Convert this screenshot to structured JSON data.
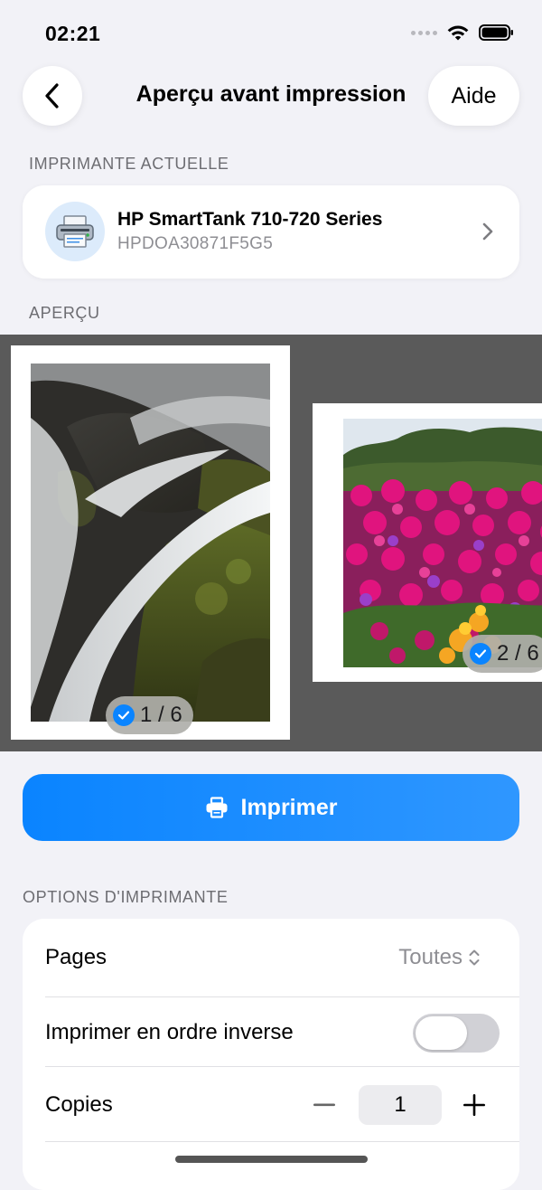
{
  "status_bar": {
    "time": "02:21"
  },
  "nav": {
    "title": "Aperçu avant impression",
    "help_label": "Aide"
  },
  "printer_section": {
    "label": "IMPRIMANTE ACTUELLE",
    "printer_name": "HP SmartTank 710-720 Series",
    "printer_id": "HPDOA30871F5G5"
  },
  "preview_section": {
    "label": "APERÇU",
    "pages": [
      {
        "badge": "1 / 6",
        "selected": true,
        "image": "waterfall-photo"
      },
      {
        "badge": "2 / 6",
        "selected": true,
        "image": "flowers-photo"
      }
    ]
  },
  "print_button": {
    "label": "Imprimer"
  },
  "options_section": {
    "label": "OPTIONS D'IMPRIMANTE",
    "pages_label": "Pages",
    "pages_value": "Toutes",
    "reverse_label": "Imprimer en ordre inverse",
    "reverse_on": false,
    "copies_label": "Copies",
    "copies_value": "1"
  },
  "colors": {
    "accent": "#0a84ff",
    "background": "#f2f2f7",
    "preview_bg": "#5a5a5a"
  }
}
